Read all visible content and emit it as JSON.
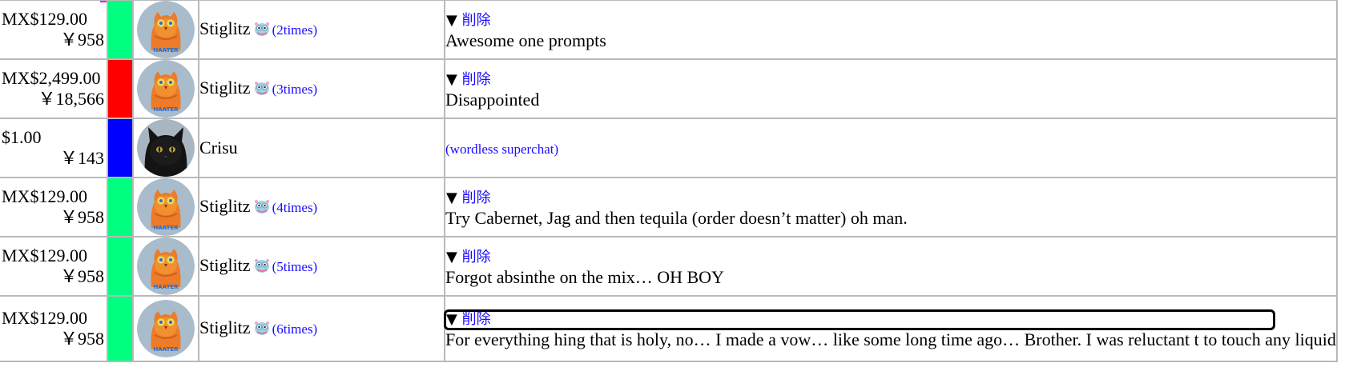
{
  "rows": [
    {
      "amount": "MX$129.00",
      "yen": "￥958",
      "color": "#00ff80",
      "avatar": "owl-avatar",
      "name": "Stiglitz",
      "times": "(2times)",
      "toggle_arrow": "▼",
      "toggle_label": "削除",
      "message": "Awesome one prompts"
    },
    {
      "amount": "MX$2,499.00",
      "yen": "￥18,566",
      "color": "#ff0000",
      "avatar": "owl-avatar",
      "name": "Stiglitz",
      "times": "(3times)",
      "toggle_arrow": "▼",
      "toggle_label": "削除",
      "message": "Disappointed"
    },
    {
      "amount": "$1.00",
      "yen": "￥143",
      "color": "#0000ff",
      "avatar": "cat-avatar",
      "name": "Crisu",
      "wordless": "(wordless superchat)"
    },
    {
      "amount": "MX$129.00",
      "yen": "￥958",
      "color": "#00ff80",
      "avatar": "owl-avatar",
      "name": "Stiglitz",
      "times": "(4times)",
      "toggle_arrow": "▼",
      "toggle_label": "削除",
      "message": "Try Cabernet, Jag and then tequila (order doesn’t matter) oh man."
    },
    {
      "amount": "MX$129.00",
      "yen": "￥958",
      "color": "#00ff80",
      "avatar": "owl-avatar",
      "name": "Stiglitz",
      "times": "(5times)",
      "toggle_arrow": "▼",
      "toggle_label": "削除",
      "message": "Forgot absinthe on the mix… OH BOY"
    },
    {
      "amount": "MX$129.00",
      "yen": "￥958",
      "color": "#00ff80",
      "avatar": "owl-avatar",
      "name": "Stiglitz",
      "times": "(6times)",
      "toggle_arrow": "▼",
      "toggle_label": "削除",
      "message": "For everything hing that is holy, no… I made a vow… like some long time ago… Brother. I was reluctant t to touch any liquid"
    }
  ],
  "top_strip_color": "#ff00ff"
}
